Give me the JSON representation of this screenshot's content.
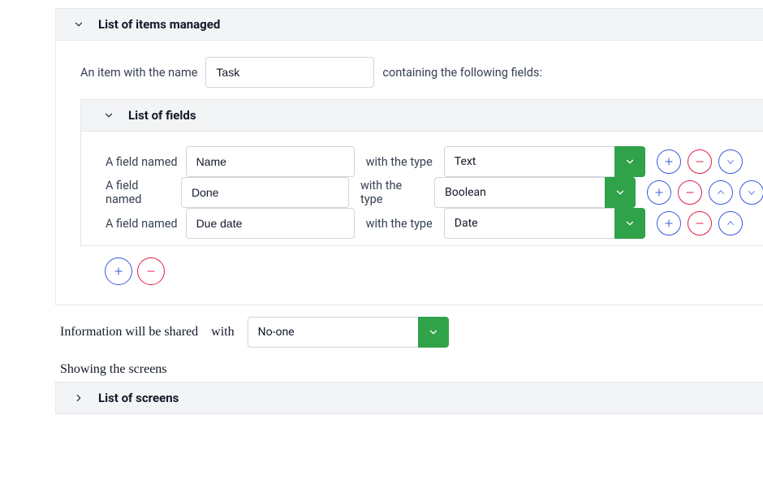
{
  "items_panel": {
    "title": "List of items managed",
    "item_label_prefix": "An item with the name",
    "item_name": "Task",
    "item_label_suffix": "containing the following fields:"
  },
  "fields_panel": {
    "title": "List of fields",
    "row_label": "A field named",
    "type_label": "with the type",
    "rows": [
      {
        "name": "Name",
        "type": "Text"
      },
      {
        "name": "Done",
        "type": "Boolean"
      },
      {
        "name": "Due date",
        "type": "Date"
      }
    ]
  },
  "share": {
    "prefix": "Information will be shared",
    "with": "with",
    "value": "No-one"
  },
  "screens": {
    "heading": "Showing the screens",
    "panel_title": "List of screens"
  }
}
